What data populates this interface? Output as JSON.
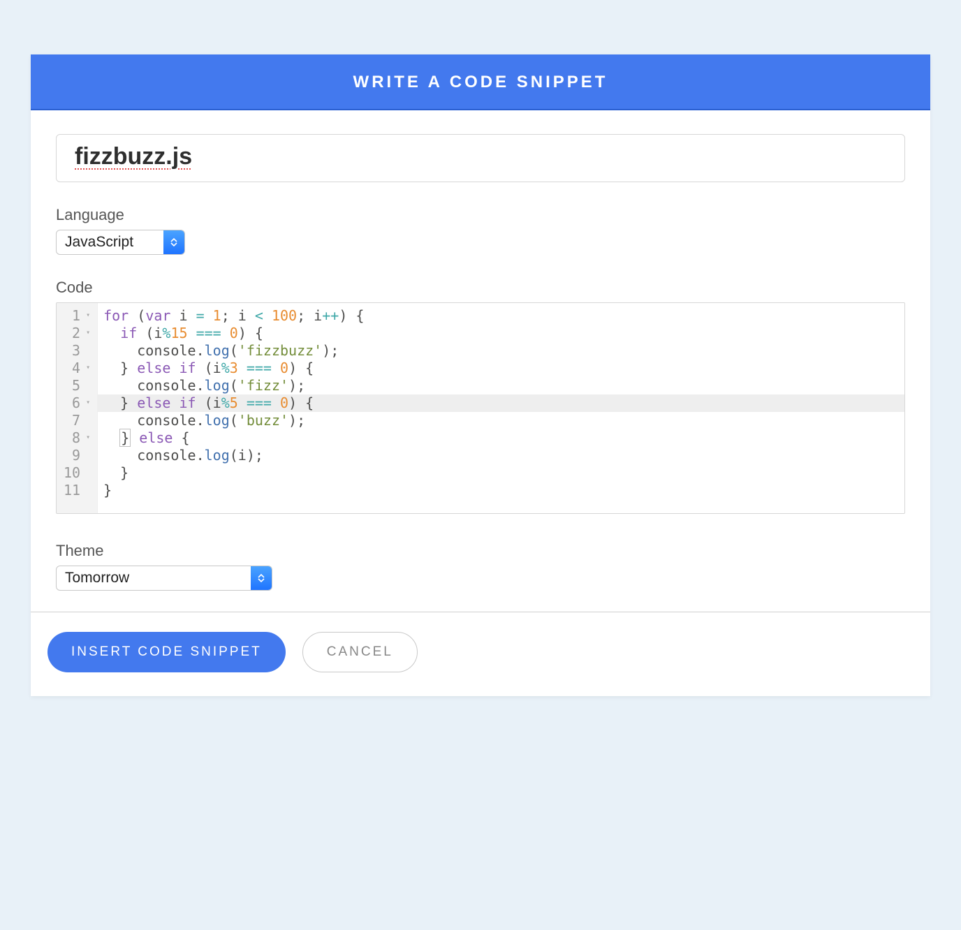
{
  "header": {
    "title": "WRITE A CODE SNIPPET"
  },
  "filename": {
    "value": "fizzbuzz.js"
  },
  "language": {
    "label": "Language",
    "selected": "JavaScript"
  },
  "code": {
    "label": "Code",
    "highlight_line": 6,
    "lines": [
      {
        "n": 1,
        "fold": true,
        "tokens": [
          [
            "kw",
            "for"
          ],
          [
            "punct",
            " ("
          ],
          [
            "kw",
            "var"
          ],
          [
            "var",
            " i "
          ],
          [
            "op",
            "="
          ],
          [
            "punct",
            " "
          ],
          [
            "num",
            "1"
          ],
          [
            "punct",
            "; i "
          ],
          [
            "op",
            "<"
          ],
          [
            "punct",
            " "
          ],
          [
            "num",
            "100"
          ],
          [
            "punct",
            "; i"
          ],
          [
            "op",
            "++"
          ],
          [
            "punct",
            ") {"
          ]
        ]
      },
      {
        "n": 2,
        "fold": true,
        "tokens": [
          [
            "punct",
            "  "
          ],
          [
            "kw",
            "if"
          ],
          [
            "punct",
            " (i"
          ],
          [
            "op",
            "%"
          ],
          [
            "num",
            "15"
          ],
          [
            "punct",
            " "
          ],
          [
            "op",
            "==="
          ],
          [
            "punct",
            " "
          ],
          [
            "num",
            "0"
          ],
          [
            "punct",
            ") {"
          ]
        ]
      },
      {
        "n": 3,
        "fold": false,
        "tokens": [
          [
            "punct",
            "    "
          ],
          [
            "obj",
            "console"
          ],
          [
            "punct",
            "."
          ],
          [
            "fn",
            "log"
          ],
          [
            "punct",
            "("
          ],
          [
            "str",
            "'fizzbuzz'"
          ],
          [
            "punct",
            ");"
          ]
        ]
      },
      {
        "n": 4,
        "fold": true,
        "tokens": [
          [
            "punct",
            "  } "
          ],
          [
            "kw",
            "else"
          ],
          [
            "punct",
            " "
          ],
          [
            "kw",
            "if"
          ],
          [
            "punct",
            " (i"
          ],
          [
            "op",
            "%"
          ],
          [
            "num",
            "3"
          ],
          [
            "punct",
            " "
          ],
          [
            "op",
            "==="
          ],
          [
            "punct",
            " "
          ],
          [
            "num",
            "0"
          ],
          [
            "punct",
            ") {"
          ]
        ]
      },
      {
        "n": 5,
        "fold": false,
        "tokens": [
          [
            "punct",
            "    "
          ],
          [
            "obj",
            "console"
          ],
          [
            "punct",
            "."
          ],
          [
            "fn",
            "log"
          ],
          [
            "punct",
            "("
          ],
          [
            "str",
            "'fizz'"
          ],
          [
            "punct",
            ");"
          ]
        ]
      },
      {
        "n": 6,
        "fold": true,
        "tokens": [
          [
            "punct",
            "  } "
          ],
          [
            "kw",
            "else"
          ],
          [
            "punct",
            " "
          ],
          [
            "kw",
            "if"
          ],
          [
            "punct",
            " (i"
          ],
          [
            "op",
            "%"
          ],
          [
            "num",
            "5"
          ],
          [
            "punct",
            " "
          ],
          [
            "op",
            "==="
          ],
          [
            "punct",
            " "
          ],
          [
            "num",
            "0"
          ],
          [
            "punct",
            ") {"
          ]
        ]
      },
      {
        "n": 7,
        "fold": false,
        "tokens": [
          [
            "punct",
            "    "
          ],
          [
            "obj",
            "console"
          ],
          [
            "punct",
            "."
          ],
          [
            "fn",
            "log"
          ],
          [
            "punct",
            "("
          ],
          [
            "str",
            "'buzz'"
          ],
          [
            "punct",
            ");"
          ]
        ]
      },
      {
        "n": 8,
        "fold": true,
        "tokens": [
          [
            "punct",
            "  "
          ],
          [
            "bracket",
            "}"
          ],
          [
            "punct",
            " "
          ],
          [
            "kw",
            "else"
          ],
          [
            "punct",
            " {"
          ]
        ]
      },
      {
        "n": 9,
        "fold": false,
        "tokens": [
          [
            "punct",
            "    "
          ],
          [
            "obj",
            "console"
          ],
          [
            "punct",
            "."
          ],
          [
            "fn",
            "log"
          ],
          [
            "punct",
            "(i);"
          ]
        ]
      },
      {
        "n": 10,
        "fold": false,
        "tokens": [
          [
            "punct",
            "  }"
          ]
        ]
      },
      {
        "n": 11,
        "fold": false,
        "tokens": [
          [
            "punct",
            "}"
          ]
        ]
      }
    ]
  },
  "theme": {
    "label": "Theme",
    "selected": "Tomorrow"
  },
  "footer": {
    "insert": "INSERT CODE SNIPPET",
    "cancel": "CANCEL"
  }
}
